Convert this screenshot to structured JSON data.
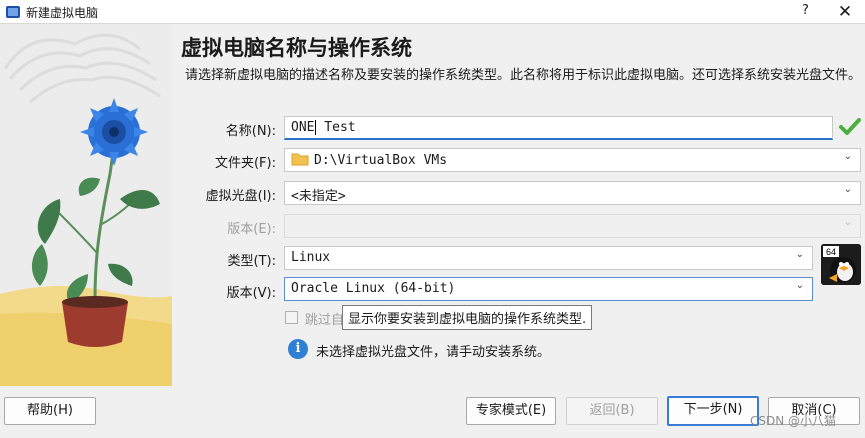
{
  "window": {
    "title": "新建虚拟电脑",
    "help_glyph": "?",
    "close_glyph": "✕"
  },
  "page": {
    "heading": "虚拟电脑名称与操作系统",
    "description": "请选择新虚拟电脑的描述名称及要安装的操作系统类型。此名称将用于标识此虚拟电脑。还可选择系统安装光盘文件。"
  },
  "form": {
    "name_label": "名称(N):",
    "name_value_before_caret": "ONE",
    "name_value_after_caret": " Test",
    "folder_label": "文件夹(F):",
    "folder_value": "D:\\VirtualBox VMs",
    "iso_label": "虚拟光盘(I):",
    "iso_value": "<未指定>",
    "edition_label": "版本(E):",
    "edition_value": "",
    "type_label": "类型(T):",
    "type_value": "Linux",
    "version_label": "版本(V):",
    "version_value": "Oracle Linux (64-bit)",
    "skip_label_visible": "跳过自",
    "skip_checked": false,
    "os_badge_text": "64"
  },
  "tooltip": "显示你要安装到虚拟电脑的操作系统类型.",
  "info_message": "未选择虚拟光盘文件，请手动安装系统。",
  "buttons": {
    "help": "帮助(H)",
    "expert": "专家模式(E)",
    "back": "返回(B)",
    "next": "下一步(N)",
    "cancel": "取消(C)"
  },
  "watermark": "CSDN @小八猫",
  "colors": {
    "accent_blue": "#3a7bd5",
    "valid_green": "#4caf3f",
    "flower_blue": "#2a6fd6"
  },
  "icons": {
    "valid": "checkmark-icon",
    "info": "info-icon",
    "folder": "folder-icon",
    "os": "linux-penguin-icon"
  }
}
